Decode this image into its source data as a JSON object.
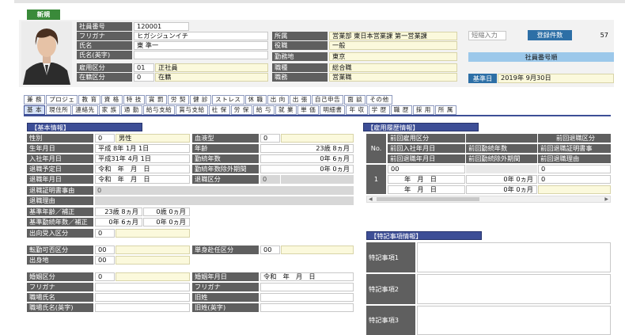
{
  "badge": "新規",
  "top": {
    "emp_no_label": "社員番号",
    "emp_no": "120001",
    "furigana_label": "フリガナ",
    "furigana": "ヒガシジュンイチ",
    "name_label": "氏名",
    "name": "東 準一",
    "name_en_label": "氏名(英字)",
    "name_en": "",
    "emp_type_label": "雇用区分",
    "emp_type_code": "01",
    "emp_type": "正社員",
    "status_label": "在籍区分",
    "status_code": "0",
    "status": "在籍",
    "dept_label": "所属",
    "dept": "営業部 東日本営業課 第一営業課",
    "post_label": "役職",
    "post": "一般",
    "loc_label": "勤務地",
    "loc": "東京",
    "job_label": "職種",
    "job": "総合職",
    "grade_label": "職務",
    "grade": "営業職",
    "short_input": "短縮入力",
    "count_label": "登録件数",
    "count": "57",
    "sort_label": "社員番号順",
    "base_date_label": "基準日",
    "base_date": "2019年 9月30日"
  },
  "tabs_row1": [
    "兼 務",
    "プロジェ",
    "教 育",
    "資 格",
    "特 技",
    "賞 罰",
    "労 契",
    "健 診",
    "ストレス",
    "休 職",
    "出 向",
    "出 張",
    "自己申告",
    "面 談",
    "その他"
  ],
  "tabs_row2": [
    "基 本",
    "現住所",
    "連絡先",
    "家 族",
    "通 勤",
    "給与支給",
    "賞与支給",
    "社 保",
    "労 保",
    "給 与",
    "就 業",
    "単 価",
    "明細書",
    "年 収",
    "学 歴",
    "職 歴",
    "採 用",
    "所 属"
  ],
  "basic": {
    "title": "【基本情報】",
    "sex_label": "性別",
    "sex_code": "0",
    "sex": "男性",
    "blood_label": "血液型",
    "blood_code": "0",
    "blood": "",
    "birth_label": "生年月日",
    "birth": "平成 8年 1月 1日",
    "age_label": "年齢",
    "age": "23歳 8ヵ月",
    "join_label": "入社年月日",
    "join": "平成31年 4月 1日",
    "years_label": "勤続年数",
    "years": "0年 6ヵ月",
    "retire_plan_label": "退職予定日",
    "retire_plan": "令和　年　月　日",
    "excl_label": "勤続年数除外期間",
    "excl": "0年 0ヵ月",
    "retire_label": "退職年月日",
    "retire": "令和　年　月　日",
    "retire_type_label": "退職区分",
    "retire_type": "0",
    "cert_label": "退職証明書事由",
    "cert": "0",
    "reason_label": "退職理由",
    "reason": "",
    "base_age_label": "基準年齢／補正",
    "base_age": "23歳 8ヵ月",
    "base_age2": "0歳 0ヵ月",
    "base_years_label": "基準勤続年数／補正",
    "base_years": "0年 6ヵ月",
    "base_years2": "0年 0ヵ月",
    "transfer_label": "出向受入区分",
    "transfer": "0",
    "relocate_label": "転勤可否区分",
    "relocate": "00",
    "single_label": "単身赴任区分",
    "single": "00",
    "origin_label": "出身地",
    "origin": "00",
    "married_label": "婚姻区分",
    "married": "0",
    "mdate_label": "婚姻年月日",
    "mdate": "令和　年　月　日",
    "furi2_label": "フリガナ",
    "furi2": "",
    "furi3_label": "フリガナ",
    "furi3": "",
    "work_name_label": "職場氏名",
    "work_name": "",
    "old_label": "旧姓",
    "old": "",
    "work_name_en_label": "職場氏名(英字)",
    "work_name_en": "",
    "old_en_label": "旧姓(英字)",
    "old_en": ""
  },
  "history": {
    "title": "【雇用履歴情報】",
    "no": "No.",
    "h1": "前回雇用区分",
    "h2": "前回退職区分",
    "h3": "前回入社年月日",
    "h4": "前回勤続年数",
    "h5": "前回退職証明書事",
    "h6": "前回退職年月日",
    "h7": "前回勤続除外期間",
    "h8": "前回退職理由",
    "row_no": "1",
    "r1": "00",
    "r2": "0",
    "r3": "年　月　日",
    "r4": "0年 0ヵ月",
    "r5": "0",
    "r6": "年　月　日",
    "r7": "0年 0ヵ月"
  },
  "special": {
    "title": "【特記事項情報】",
    "i1": "特記事項1",
    "i2": "特記事項2",
    "i3": "特記事項3"
  }
}
